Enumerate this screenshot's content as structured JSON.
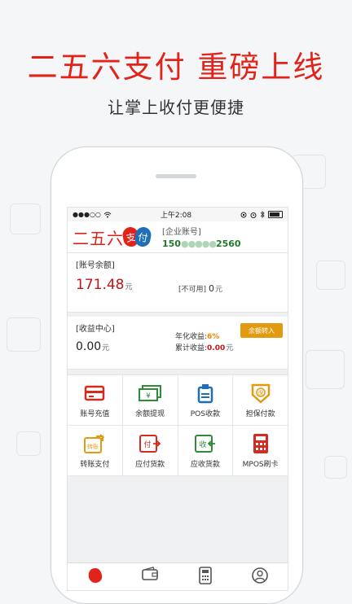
{
  "promo": {
    "headline": "二五六支付 重磅上线",
    "subline": "让掌上收付更便捷"
  },
  "statusbar": {
    "signal_dots": "●●●○○",
    "time": "上午2:08"
  },
  "header": {
    "logo_text": "二五六",
    "logo_char1": "支",
    "logo_char2": "付",
    "account_label": "[企业账号]",
    "account_prefix": "150",
    "account_mask": "●●●●●",
    "account_suffix": "2560"
  },
  "balance": {
    "label": "[账号余额]",
    "value": "171.48",
    "unit": "元",
    "unavailable_label": "[不可用]",
    "unavailable_value": "0",
    "unavailable_unit": "元"
  },
  "earnings": {
    "label": "[收益中心]",
    "value": "0.00",
    "unit": "元",
    "annual_label": "年化收益:",
    "annual_value": "6%",
    "accum_label": "累计收益:",
    "accum_value": "0.00",
    "accum_unit": "元",
    "transfer_button": "余额转入"
  },
  "grid": [
    {
      "label": "账号充值",
      "icon": "card-icon"
    },
    {
      "label": "余额提现",
      "icon": "cash-icon"
    },
    {
      "label": "POS收款",
      "icon": "pos-icon"
    },
    {
      "label": "担保付款",
      "icon": "guarantee-icon"
    },
    {
      "label": "转账支付",
      "icon": "transfer-icon"
    },
    {
      "label": "应付货款",
      "icon": "payable-icon"
    },
    {
      "label": "应收货款",
      "icon": "receivable-icon"
    },
    {
      "label": "MPOS刷卡",
      "icon": "mpos-icon"
    }
  ],
  "tabs": [
    {
      "icon": "home-b2b-icon"
    },
    {
      "icon": "wallet-icon"
    },
    {
      "icon": "calculator-icon"
    },
    {
      "icon": "user-icon"
    }
  ],
  "colors": {
    "brand_red": "#e2231a",
    "brand_blue": "#1f6fb5",
    "accent_orange": "#e39a10",
    "balance_red": "#c41414",
    "account_green": "#1d7a2c"
  }
}
